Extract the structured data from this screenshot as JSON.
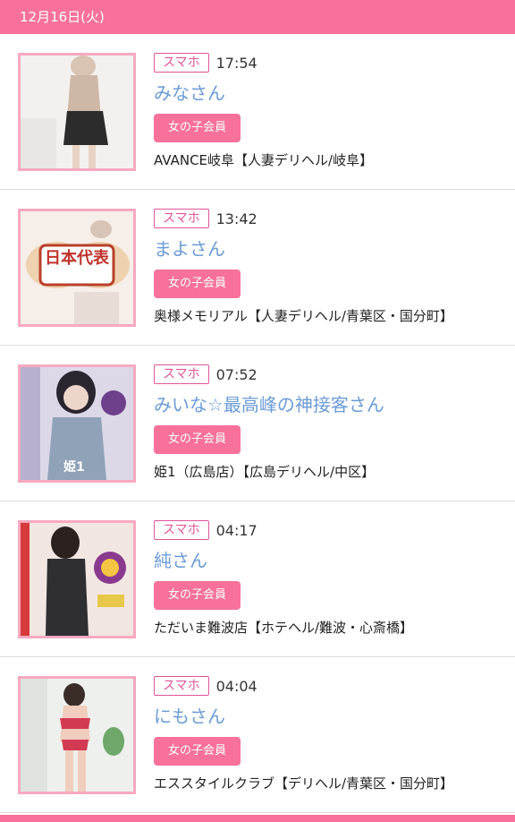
{
  "header": {
    "date": "12月16日(火)"
  },
  "colors": {
    "accent": "#f7719a",
    "tag_border": "#e0559a",
    "name_link": "#6b9bd6",
    "thumb_border": "#f7a9c0"
  },
  "entries": [
    {
      "tag": "スマホ",
      "time": "17:54",
      "name": "みなさん",
      "badge": "女の子会員",
      "shop": "AVANCE岐阜【人妻デリヘル/岐阜】"
    },
    {
      "tag": "スマホ",
      "time": "13:42",
      "name": "まよさん",
      "badge": "女の子会員",
      "shop": "奥様メモリアル【人妻デリヘル/青葉区・国分町】",
      "image_text": "日本代表"
    },
    {
      "tag": "スマホ",
      "time": "07:52",
      "name": "みいな☆最高峰の神接客さん",
      "badge": "女の子会員",
      "shop": "姫1（広島店）【広島デリヘル/中区】",
      "image_text": "姫1"
    },
    {
      "tag": "スマホ",
      "time": "04:17",
      "name": "純さん",
      "badge": "女の子会員",
      "shop": "ただいま難波店【ホテヘル/難波・心斎橋】"
    },
    {
      "tag": "スマホ",
      "time": "04:04",
      "name": "にもさん",
      "badge": "女の子会員",
      "shop": "エススタイルクラブ【デリヘル/青葉区・国分町】"
    }
  ]
}
